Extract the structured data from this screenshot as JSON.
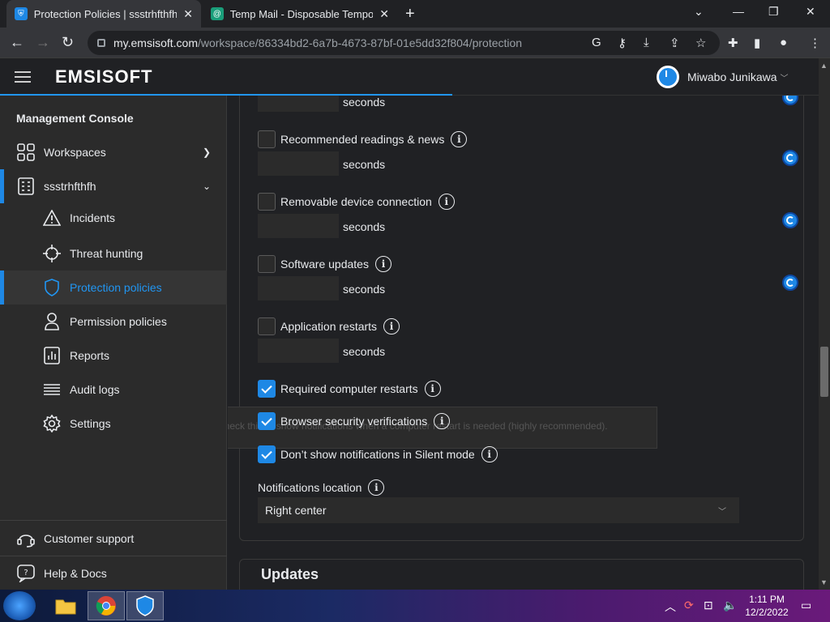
{
  "browser": {
    "tabs": [
      {
        "title": "Protection Policies | ssstrhfthfh | E",
        "active": true
      },
      {
        "title": "Temp Mail - Disposable Tempora",
        "active": false
      }
    ],
    "url_host": "my.emsisoft.com",
    "url_path": "/workspace/86334bd2-6a7b-4673-87bf-01e5dd32f804/protection"
  },
  "app": {
    "logo": "EMSISOFT",
    "user_name": "Miwabo Junikawa"
  },
  "sidebar": {
    "title": "Management Console",
    "items": [
      {
        "label": "Workspaces"
      },
      {
        "label": "ssstrhfthfh"
      },
      {
        "label": "Incidents"
      },
      {
        "label": "Threat hunting"
      },
      {
        "label": "Protection policies"
      },
      {
        "label": "Permission policies"
      },
      {
        "label": "Reports"
      },
      {
        "label": "Audit logs"
      },
      {
        "label": "Settings"
      }
    ],
    "footer": [
      {
        "label": "Customer support"
      },
      {
        "label": "Help & Docs"
      }
    ]
  },
  "main": {
    "seconds_label": "seconds",
    "options": [
      {
        "label": "Recommended readings & news",
        "checked": false
      },
      {
        "label": "Removable device connection",
        "checked": false
      },
      {
        "label": "Software updates",
        "checked": false
      },
      {
        "label": "Application restarts",
        "checked": false
      },
      {
        "label": "Required computer restarts",
        "checked": true
      },
      {
        "label": "Browser security verifications",
        "checked": true
      },
      {
        "label": "Don’t show notifications in Silent mode",
        "checked": true
      }
    ],
    "tooltip": "Check this to show notifications when a computer restart is needed (highly recommended).",
    "notif_location_label": "Notifications location",
    "notif_location_value": "Right center",
    "updates_header": "Updates"
  },
  "taskbar": {
    "time": "1:11 PM",
    "date": "12/2/2022"
  },
  "colors": {
    "accent": "#1e88e5",
    "sidebar_bg": "#2b2b2b",
    "page_bg": "#202124"
  }
}
